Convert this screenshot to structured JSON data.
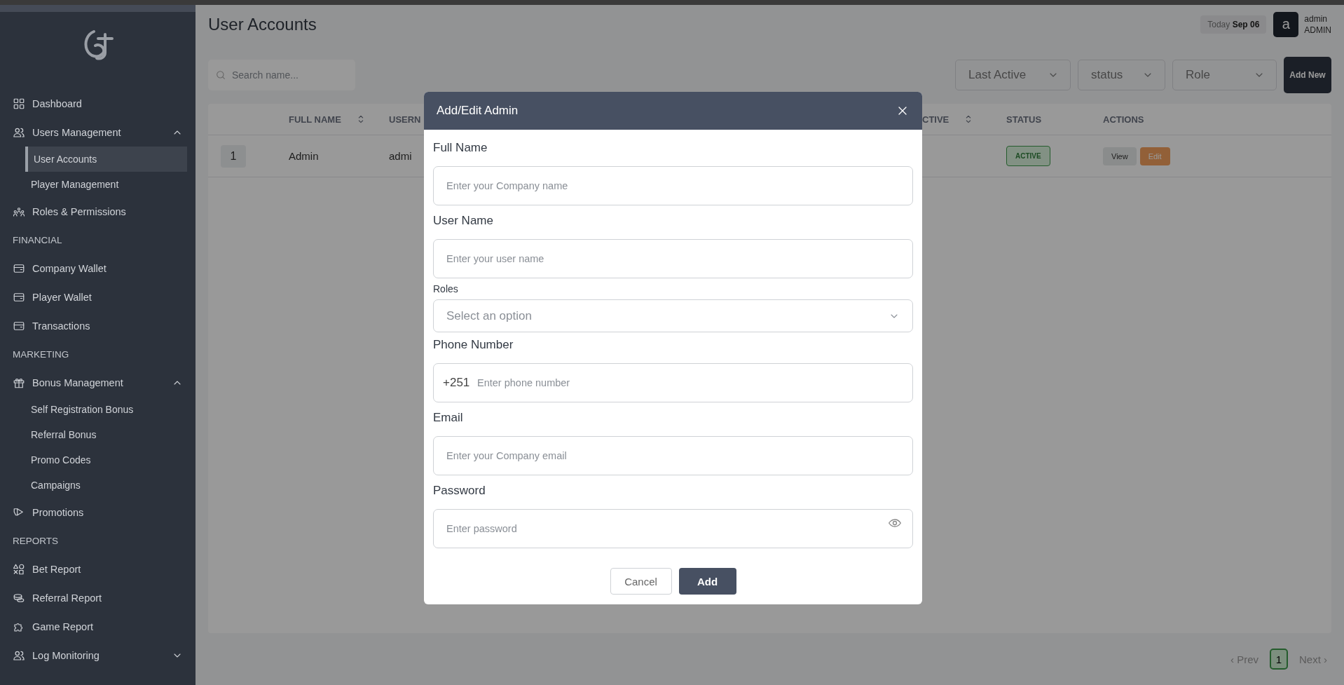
{
  "sidebar": {
    "items": [
      {
        "kind": "link",
        "label": "Dashboard",
        "selected": false
      },
      {
        "kind": "group",
        "label": "Users Management",
        "expanded": true,
        "children": [
          {
            "label": "User Accounts",
            "selected": true
          },
          {
            "label": "Player Management",
            "selected": false
          }
        ]
      },
      {
        "kind": "link",
        "label": "Roles & Permissions",
        "selected": false
      },
      {
        "kind": "section",
        "label": "FINANCIAL"
      },
      {
        "kind": "link",
        "label": "Company Wallet",
        "selected": false
      },
      {
        "kind": "link",
        "label": "Player Wallet",
        "selected": false
      },
      {
        "kind": "link",
        "label": "Transactions",
        "selected": false
      },
      {
        "kind": "section",
        "label": "MARKETING"
      },
      {
        "kind": "group",
        "label": "Bonus Management",
        "expanded": true,
        "children": [
          {
            "label": "Self Registration Bonus",
            "selected": false
          },
          {
            "label": "Referral Bonus",
            "selected": false
          },
          {
            "label": "Promo Codes",
            "selected": false
          },
          {
            "label": "Campaigns",
            "selected": false
          }
        ]
      },
      {
        "kind": "link",
        "label": "Promotions",
        "selected": false
      },
      {
        "kind": "section",
        "label": "REPORTS"
      },
      {
        "kind": "link",
        "label": "Bet Report",
        "selected": false
      },
      {
        "kind": "link",
        "label": "Referral Report",
        "selected": false
      },
      {
        "kind": "link",
        "label": "Game Report",
        "selected": false
      },
      {
        "kind": "group",
        "label": "Log Monitoring",
        "expanded": false
      }
    ]
  },
  "header": {
    "title": "User Accounts",
    "today_label": "Today",
    "date": "Sep 06",
    "avatar_letter": "a",
    "user_name": "admin",
    "user_role": "ADMIN"
  },
  "filters": {
    "search_placeholder": "Search name...",
    "dropdowns": [
      "Last Active",
      "status",
      "Role"
    ],
    "add_button": "Add New"
  },
  "table": {
    "columns": [
      {
        "label": "FULL NAME",
        "sortable": true
      },
      {
        "label": "USERN",
        "sortable": false
      },
      {
        "label": "CTIVE",
        "sortable": true
      },
      {
        "label": "STATUS",
        "sortable": false
      },
      {
        "label": "ACTIONS",
        "sortable": false
      }
    ],
    "rows": [
      {
        "number": "1",
        "full_name": "Admin",
        "username": "admi",
        "status": "ACTIVE",
        "actions": [
          {
            "label": "View",
            "kind": "view"
          },
          {
            "label": "Edit",
            "kind": "edit"
          }
        ]
      }
    ]
  },
  "pagination": {
    "prev": {
      "label": "‹ Prev",
      "disabled": true
    },
    "pages": [
      {
        "label": "1",
        "selected": true
      }
    ],
    "next": {
      "label": "Next ›",
      "disabled": true
    }
  },
  "modal": {
    "title": "Add/Edit Admin",
    "fields": [
      {
        "kind": "text",
        "label": "Full Name",
        "placeholder": "Enter your Company name"
      },
      {
        "kind": "text",
        "label": "User Name",
        "placeholder": "Enter your user name"
      },
      {
        "kind": "select",
        "label": "Roles",
        "placeholder": "Select an option"
      },
      {
        "kind": "phone",
        "label": "Phone Number",
        "prefix": "+251",
        "placeholder": "Enter phone number"
      },
      {
        "kind": "text",
        "label": "Email",
        "placeholder": "Enter your Company email"
      },
      {
        "kind": "password",
        "label": "Password",
        "placeholder": "Enter password"
      }
    ],
    "buttons": [
      {
        "label": "Cancel",
        "kind": "secondary"
      },
      {
        "label": "Add",
        "kind": "primary"
      }
    ]
  }
}
